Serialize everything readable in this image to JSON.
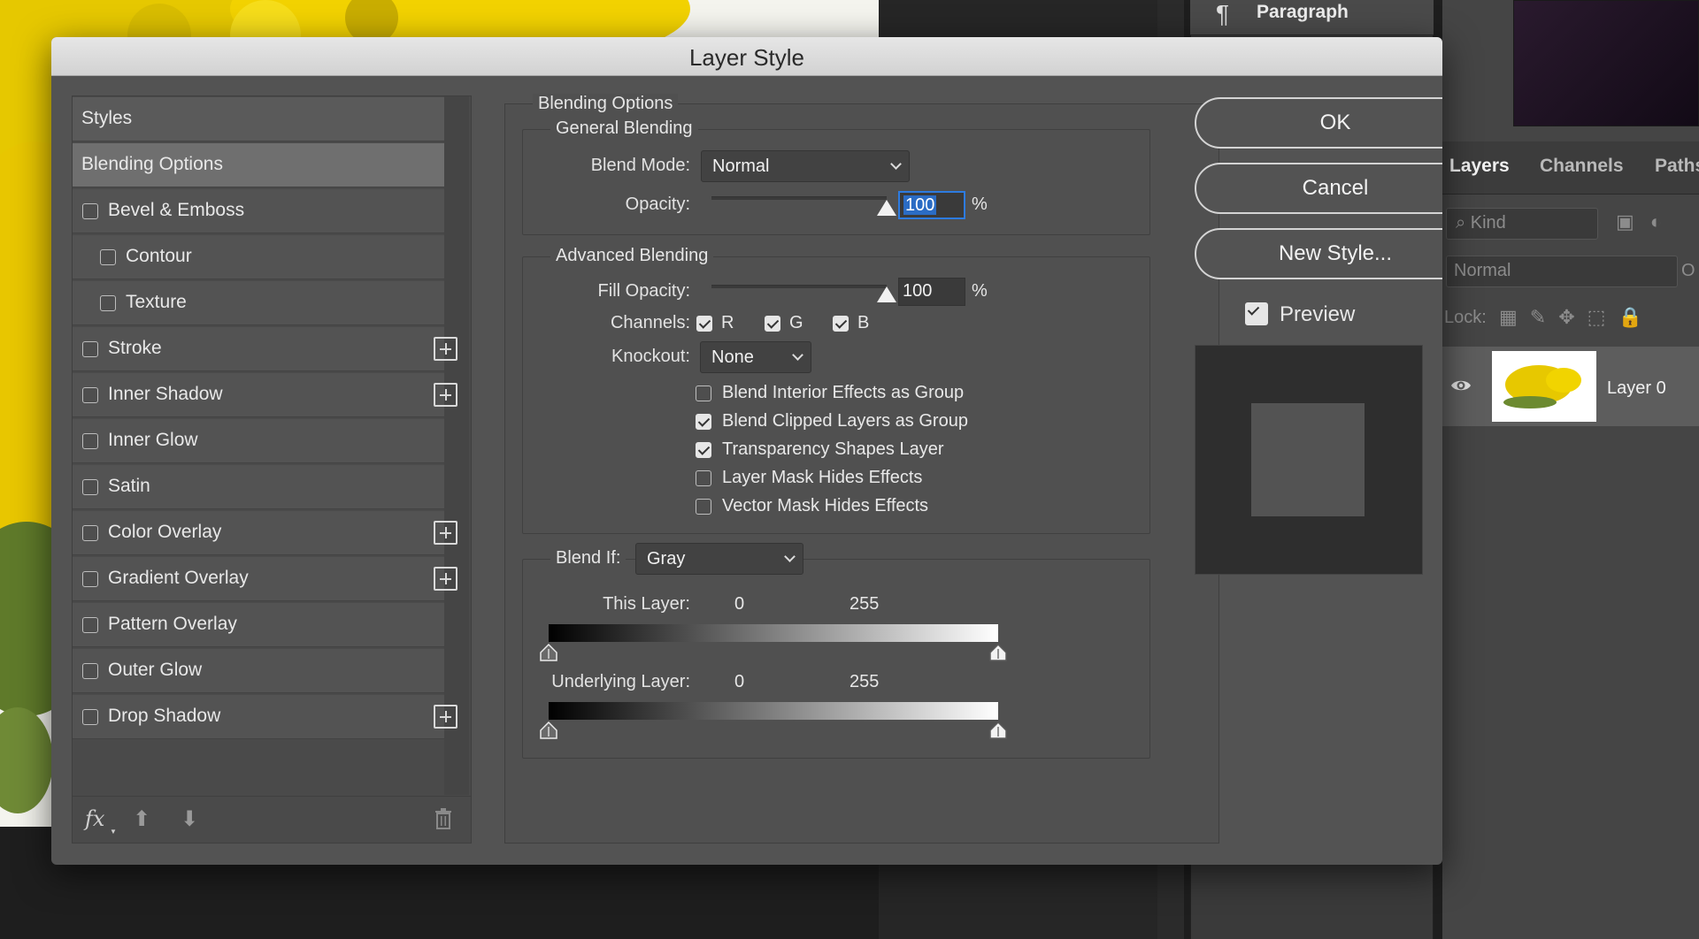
{
  "background": {
    "paragraph_panel": {
      "label": "Paragraph"
    },
    "layers_panel": {
      "tabs": [
        "Layers",
        "Channels",
        "Paths"
      ],
      "filter_kind": "Kind",
      "blend_mode": "Normal",
      "opacity_fragment": "O",
      "lock_label": "Lock:",
      "layer_name": "Layer 0"
    }
  },
  "dialog": {
    "title": "Layer Style",
    "styles_list": {
      "items": [
        {
          "label": "Styles"
        },
        {
          "label": "Blending Options"
        },
        {
          "label": "Bevel & Emboss"
        },
        {
          "label": "Contour"
        },
        {
          "label": "Texture"
        },
        {
          "label": "Stroke"
        },
        {
          "label": "Inner Shadow"
        },
        {
          "label": "Inner Glow"
        },
        {
          "label": "Satin"
        },
        {
          "label": "Color Overlay"
        },
        {
          "label": "Gradient Overlay"
        },
        {
          "label": "Pattern Overlay"
        },
        {
          "label": "Outer Glow"
        },
        {
          "label": "Drop Shadow"
        }
      ],
      "footer": {
        "fx_label": "fx"
      }
    },
    "blending_options": {
      "title": "Blending Options",
      "general": {
        "title": "General Blending",
        "blend_mode_label": "Blend Mode:",
        "blend_mode_value": "Normal",
        "opacity_label": "Opacity:",
        "opacity_value": "100",
        "opacity_unit": "%",
        "opacity_fraction": 1.0
      },
      "advanced": {
        "title": "Advanced Blending",
        "fill_opacity_label": "Fill Opacity:",
        "fill_opacity_value": "100",
        "fill_opacity_unit": "%",
        "fill_opacity_fraction": 1.0,
        "channels_label": "Channels:",
        "channels": [
          {
            "label": "R",
            "checked": true
          },
          {
            "label": "G",
            "checked": true
          },
          {
            "label": "B",
            "checked": true
          }
        ],
        "knockout_label": "Knockout:",
        "knockout_value": "None",
        "options": [
          {
            "label": "Blend Interior Effects as Group",
            "checked": false
          },
          {
            "label": "Blend Clipped Layers as Group",
            "checked": true
          },
          {
            "label": "Transparency Shapes Layer",
            "checked": true
          },
          {
            "label": "Layer Mask Hides Effects",
            "checked": false
          },
          {
            "label": "Vector Mask Hides Effects",
            "checked": false
          }
        ]
      },
      "blend_if": {
        "label": "Blend If:",
        "value": "Gray",
        "this_layer_label": "This Layer:",
        "this_layer_low": "0",
        "this_layer_high": "255",
        "underlying_label": "Underlying Layer:",
        "underlying_low": "0",
        "underlying_high": "255"
      }
    },
    "buttons": {
      "ok": "OK",
      "cancel": "Cancel",
      "new_style": "New Style...",
      "preview_label": "Preview",
      "preview_checked": true
    }
  },
  "colors": {
    "dialog_bg": "#535353",
    "titlebar": "#dcdcdc",
    "selection_accent": "#2d7be0"
  }
}
